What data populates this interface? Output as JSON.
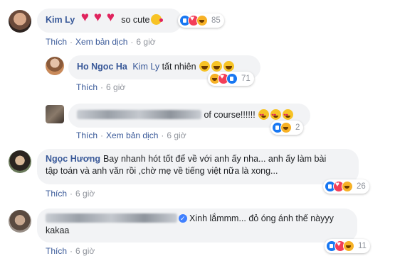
{
  "comments": [
    {
      "author": "Kim Ly",
      "text": "so cute",
      "reaction_count": "85",
      "actions": {
        "like": "Thích",
        "translate": "Xem bản dịch",
        "time": "6 giờ"
      }
    },
    {
      "author": "Ho Ngoc Ha",
      "mention": "Kim Ly",
      "text": "tất nhiên",
      "reaction_count": "71",
      "actions": {
        "like": "Thích",
        "time": "6 giờ"
      }
    },
    {
      "text": "of course!!!!!!",
      "reaction_count": "2",
      "actions": {
        "like": "Thích",
        "translate": "Xem bản dịch",
        "time": "6 giờ"
      }
    },
    {
      "author": "Ngọc Hương",
      "text_line1": "Bay nhanh hót tốt để về với anh ấy nha... anh ấy làm bài",
      "text_line2": "tập toán và anh văn rồi ,chờ mẹ về tiếng việt nữa là xong...",
      "reaction_count": "26",
      "actions": {
        "like": "Thích",
        "time": "6 giờ"
      }
    },
    {
      "text_line1": "Xinh lắmmm... đỏ óng ánh thế nàyyy",
      "text_line2": "kakaa",
      "reaction_count": "11",
      "actions": {
        "like": "Thích",
        "time": "6 giờ"
      }
    }
  ],
  "colors": {
    "author": "#385898",
    "bubble": "#f2f3f5",
    "meta": "#90949c",
    "like": "#1877f2",
    "love": "#f33e58",
    "haha": "#f7b125"
  }
}
